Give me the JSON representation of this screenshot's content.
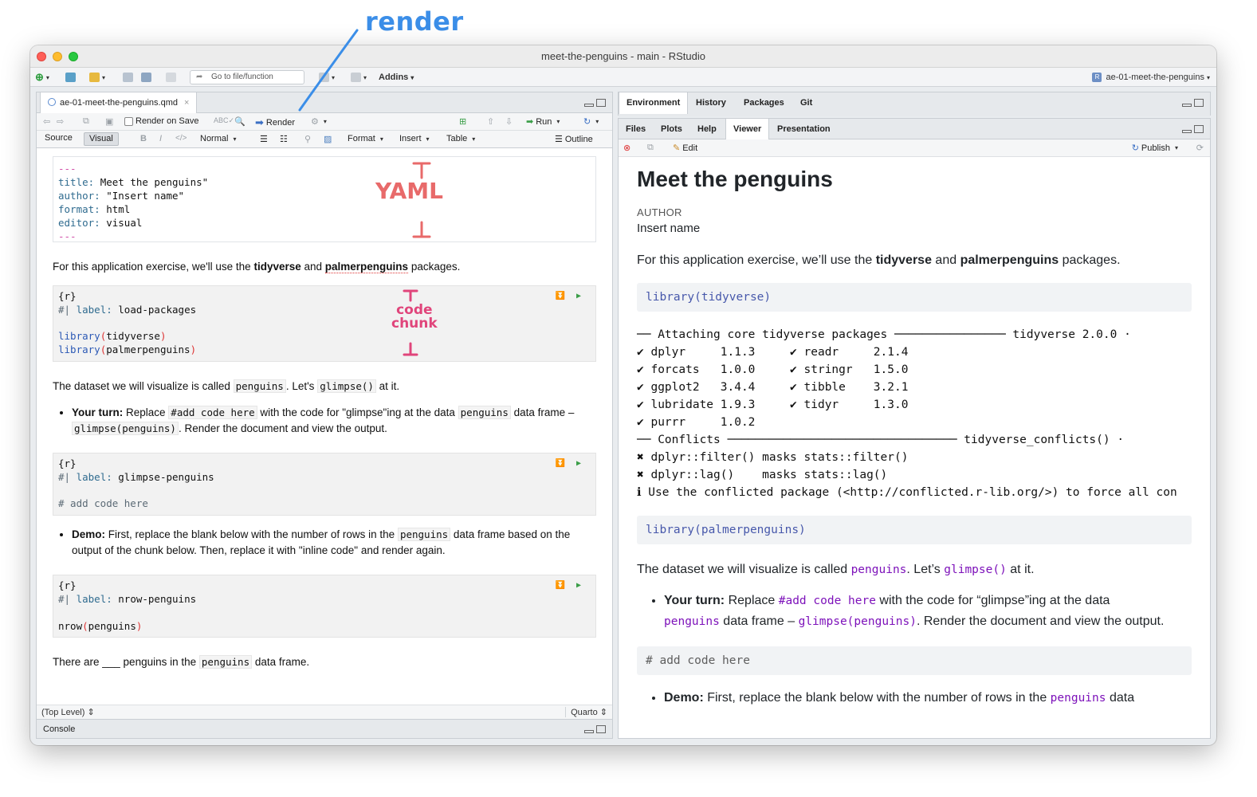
{
  "annotations": {
    "render": "render",
    "yaml": "YAML",
    "code_chunk_line1": "code",
    "code_chunk_line2": "chunk"
  },
  "window": {
    "title": "meet-the-penguins - main - RStudio"
  },
  "main_toolbar": {
    "goto_placeholder": "Go to file/function",
    "addins": "Addins",
    "project": "ae-01-meet-the-penguins"
  },
  "editor": {
    "file_tab": "ae-01-meet-the-penguins.qmd",
    "render_on_save": "Render on Save",
    "render": "Render",
    "run": "Run",
    "source": "Source",
    "visual": "Visual",
    "bold": "B",
    "italic": "I",
    "code_mark": "</>",
    "style": "Normal",
    "format": "Format",
    "insert": "Insert",
    "table": "Table",
    "outline": "Outline",
    "yaml": {
      "open": "---",
      "title_key": "title:",
      "title_val": "Meet the penguins\"",
      "author_key": "author:",
      "author_val": "\"Insert name\"",
      "format_key": "format:",
      "format_val": "html",
      "editor_key": "editor:",
      "editor_val": "visual",
      "close": "---"
    },
    "para1_a": "For this application exercise, we'll use the ",
    "para1_b": "tidyverse",
    "para1_c": " and ",
    "para1_d": "palmerpenguins",
    "para1_e": " packages.",
    "chunk1": {
      "header": "{r}",
      "opt_prefix": "#|",
      "opt_key": "label:",
      "opt_val": "load-packages",
      "l1_fn": "library",
      "l1_arg": "tidyverse",
      "l2_fn": "library",
      "l2_arg": "palmerpenguins"
    },
    "para2_a": "The dataset we will visualize is called ",
    "para2_b": "penguins",
    "para2_c": ". Let's ",
    "para2_d": "glimpse()",
    "para2_e": " at it.",
    "bullet1_a": "Your turn:",
    "bullet1_b": " Replace ",
    "bullet1_c": "#add code here",
    "bullet1_d": " with the code for \"glimpse\"ing at the data ",
    "bullet1_e": "penguins",
    "bullet1_f": " data frame –",
    "bullet1_g": "glimpse(penguins)",
    "bullet1_h": ". Render the document and view the output.",
    "chunk2": {
      "header": "{r}",
      "opt_prefix": "#|",
      "opt_key": "label:",
      "opt_val": "glimpse-penguins",
      "comment": "# add code here"
    },
    "bullet2_a": "Demo:",
    "bullet2_b": " First, replace the blank below with the number of rows in the ",
    "bullet2_c": "penguins",
    "bullet2_d": " data frame based on the output of the chunk below. Then, replace it with \"inline code\" and render again.",
    "chunk3": {
      "header": "{r}",
      "opt_prefix": "#|",
      "opt_key": "label:",
      "opt_val": "nrow-penguins",
      "l1_fn": "nrow",
      "l1_arg": "penguins"
    },
    "para3_a": "There are ___ penguins in the ",
    "para3_b": "penguins",
    "para3_c": " data frame.",
    "status_level": "(Top Level)",
    "status_mode": "Quarto",
    "console": "Console"
  },
  "right_top_tabs": [
    "Environment",
    "History",
    "Packages",
    "Git"
  ],
  "right_tabs": [
    "Files",
    "Plots",
    "Help",
    "Viewer",
    "Presentation"
  ],
  "viewer": {
    "edit": "Edit",
    "publish": "Publish",
    "title": "Meet the penguins",
    "author_label": "AUTHOR",
    "author_name": "Insert name",
    "p1_a": "For this application exercise, we’ll use the ",
    "p1_b": "tidyverse",
    "p1_c": " and ",
    "p1_d": "palmerpenguins",
    "p1_e": " packages.",
    "code1": "library(tidyverse)",
    "out_lines": [
      "── Attaching core tidyverse packages ──────────────── tidyverse 2.0.0 ·",
      "✔ dplyr     1.1.3     ✔ readr     2.1.4",
      "✔ forcats   1.0.0     ✔ stringr   1.5.0",
      "✔ ggplot2   3.4.4     ✔ tibble    3.2.1",
      "✔ lubridate 1.9.3     ✔ tidyr     1.3.0",
      "✔ purrr     1.0.2",
      "── Conflicts ───────────────────────────────── tidyverse_conflicts() ·",
      "✖ dplyr::filter() masks stats::filter()",
      "✖ dplyr::lag()    masks stats::lag()",
      "ℹ Use the conflicted package (<http://conflicted.r-lib.org/>) to force all con"
    ],
    "code2": "library(palmerpenguins)",
    "p2_a": "The dataset we will visualize is called ",
    "p2_b": "penguins",
    "p2_c": ". Let’s ",
    "p2_d": "glimpse()",
    "p2_e": " at it.",
    "b1_a": "Your turn:",
    "b1_b": " Replace ",
    "b1_c": "#add code here",
    "b1_d": " with the code for “glimpse”ing at the data",
    "b1_e": "penguins",
    "b1_f": " data frame – ",
    "b1_g": "glimpse(penguins)",
    "b1_h": ". Render the document and view the output.",
    "code3": "# add code here",
    "b2_a": "Demo:",
    "b2_b": " First, replace the blank below with the number of rows in the ",
    "b2_c": "penguins",
    "b2_d": " data"
  }
}
